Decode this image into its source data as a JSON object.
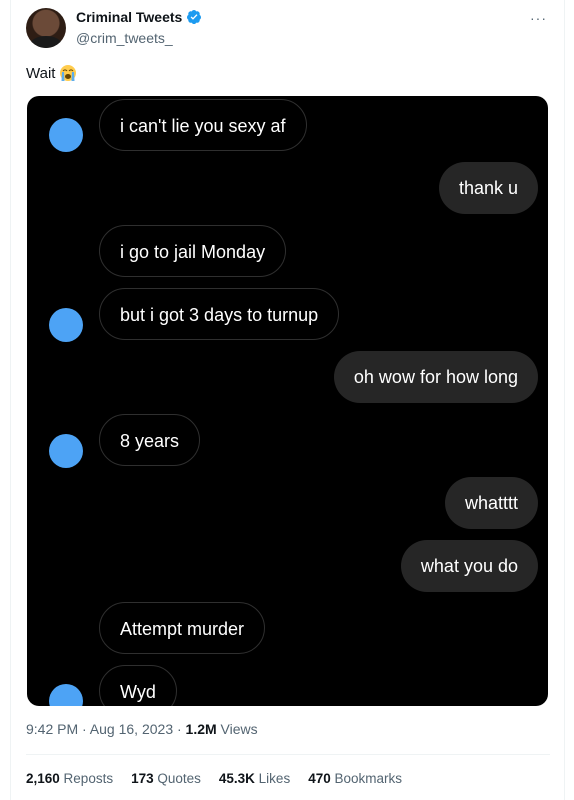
{
  "author": {
    "display_name": "Criminal Tweets",
    "handle": "@crim_tweets_",
    "verified": true,
    "avatar_icon": "profile-photo-avatar"
  },
  "tweet": {
    "text": "Wait",
    "emoji_icon": "loudly-crying-face-emoji"
  },
  "chat": {
    "messages": [
      {
        "side": "received",
        "text": "i can't lie you sexy af",
        "avatar": true
      },
      {
        "side": "sent",
        "text": "thank u"
      },
      {
        "side": "received",
        "text": "i go to jail Monday",
        "avatar": false
      },
      {
        "side": "received",
        "text": "but i got 3 days to turnup",
        "avatar": true
      },
      {
        "side": "sent",
        "text": "oh wow for how long"
      },
      {
        "side": "received",
        "text": "8 years",
        "avatar": true
      },
      {
        "side": "sent",
        "text": "whatttt"
      },
      {
        "side": "sent",
        "text": "what you do"
      },
      {
        "side": "received",
        "text": "Attempt murder",
        "avatar": false
      },
      {
        "side": "received",
        "text": "Wyd",
        "avatar": true
      }
    ],
    "colors": {
      "background": "#000000",
      "sent_bubble": "#262626",
      "avatar_dot": "#4da3f5"
    }
  },
  "meta": {
    "time_date": "9:42 PM · Aug 16, 2023 · ",
    "views_count": "1.2M",
    "views_label": " Views"
  },
  "stats": {
    "reposts_count": "2,160",
    "reposts_label": " Reposts",
    "quotes_count": "173",
    "quotes_label": " Quotes",
    "likes_count": "45.3K",
    "likes_label": " Likes",
    "bookmarks_count": "470",
    "bookmarks_label": " Bookmarks"
  },
  "more_label": "···"
}
